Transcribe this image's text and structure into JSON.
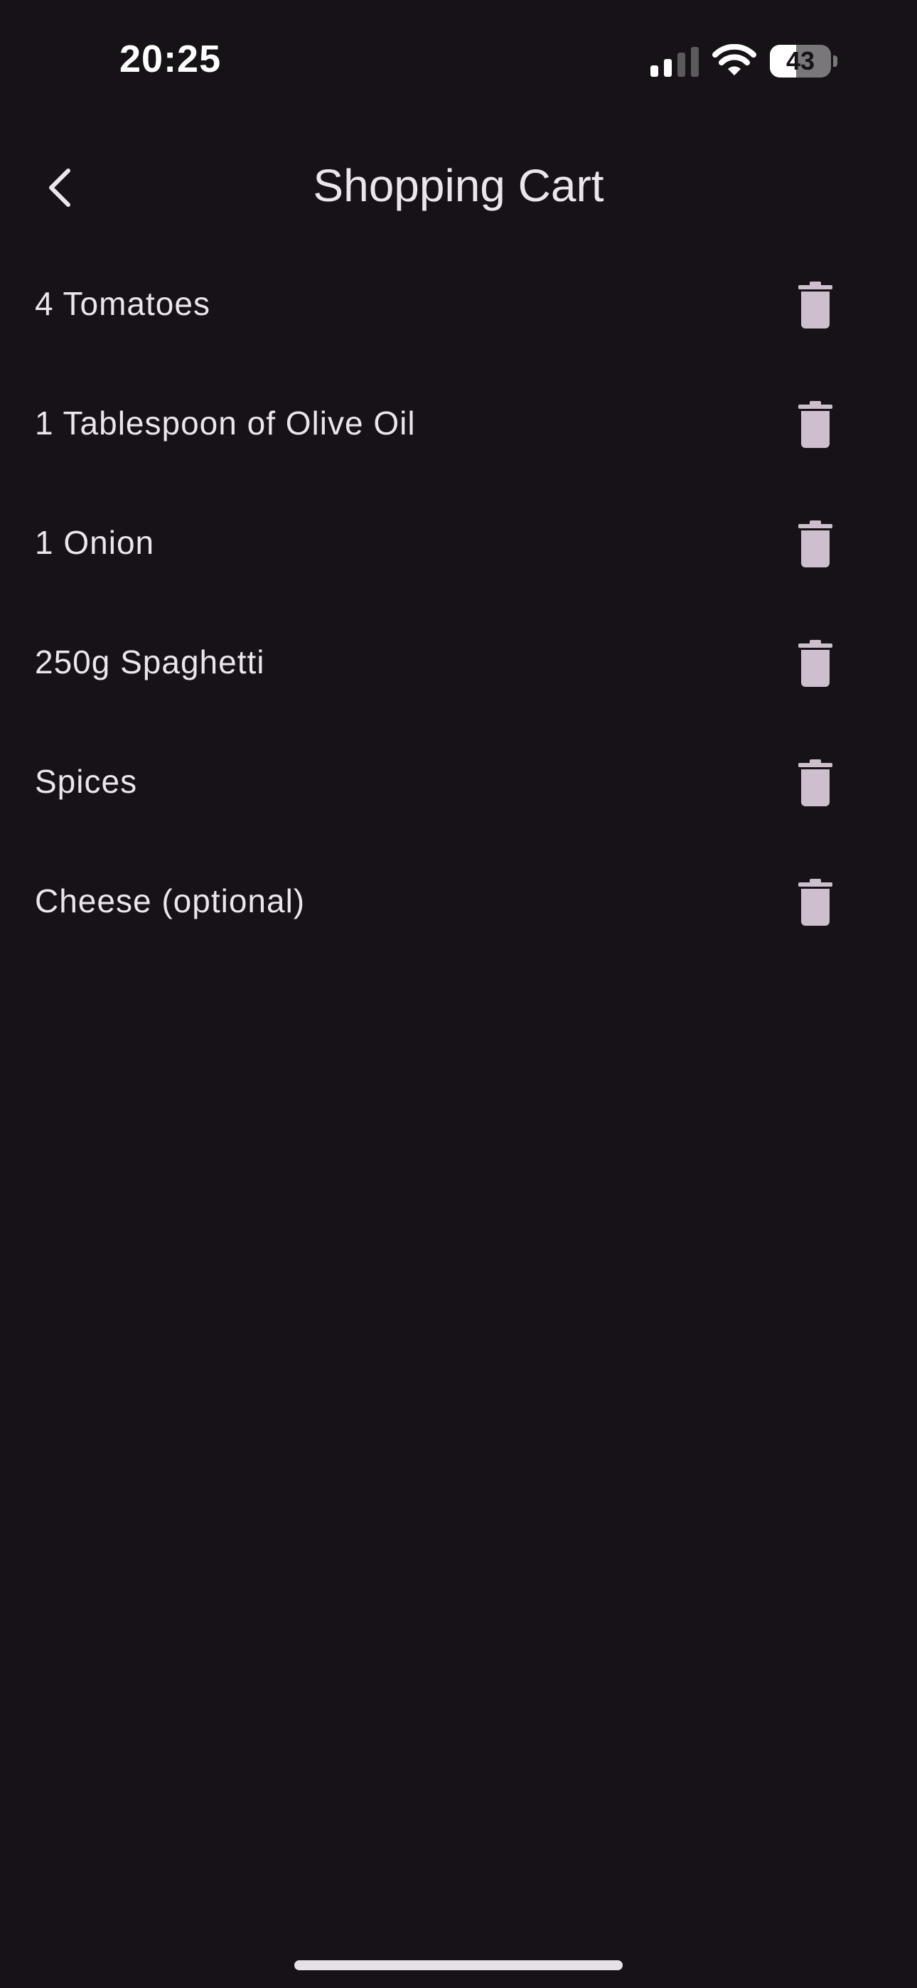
{
  "status_bar": {
    "time": "20:25",
    "battery_percent": 43,
    "battery_label": "43",
    "signal_icon": "cellular-signal-icon",
    "wifi_icon": "wifi-icon"
  },
  "header": {
    "title": "Shopping Cart",
    "back_icon": "chevron-left-icon"
  },
  "cart": {
    "items": [
      {
        "label": "4 Tomatoes"
      },
      {
        "label": "1 Tablespoon of Olive Oil"
      },
      {
        "label": "1 Onion"
      },
      {
        "label": "250g Spaghetti"
      },
      {
        "label": "Spices"
      },
      {
        "label": "Cheese (optional)"
      }
    ],
    "delete_icon": "trash-icon"
  },
  "colors": {
    "background": "#171217",
    "text": "#ece6ec",
    "icon": "#cdbfcd",
    "home_indicator": "#e6e1e6"
  }
}
